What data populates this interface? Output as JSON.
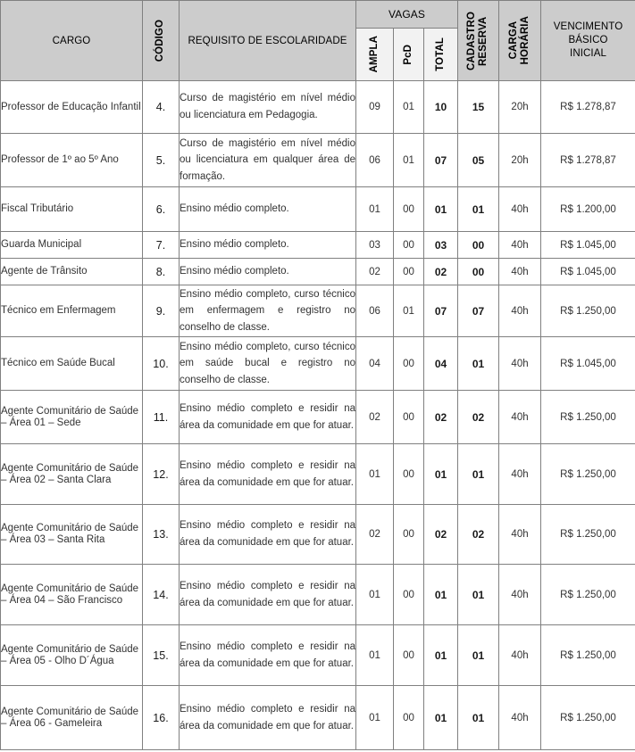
{
  "table": {
    "headers": {
      "cargo": "CARGO",
      "codigo": "CÓDIGO",
      "requisito": "REQUISITO DE ESCOLARIDADE",
      "vagas": "VAGAS",
      "ampla": "AMPLA",
      "pcd": "PcD",
      "total": "TOTAL",
      "cadastro_reserva_l1": "CADASTRO",
      "cadastro_reserva_l2": "RESERVA",
      "carga_horaria_l1": "CARGA",
      "carga_horaria_l2": "HORÁRIA",
      "vencimento_l1": "VENCIMENTO",
      "vencimento_l2": "BÁSICO",
      "vencimento_l3": "INICIAL"
    },
    "rows": [
      {
        "cargo": "Professor de Educação Infantil",
        "codigo": "4.",
        "requisito": "Curso de magistério em nível médio ou licenciatura em Pedagogia.",
        "ampla": "09",
        "pcd": "01",
        "total": "10",
        "cadastro_reserva": "15",
        "carga_horaria": "20h",
        "vencimento": "R$ 1.278,87"
      },
      {
        "cargo": "Professor de 1º ao 5º Ano",
        "codigo": "5.",
        "requisito": "Curso de magistério em nível médio ou licenciatura em qualquer área de formação.",
        "ampla": "06",
        "pcd": "01",
        "total": "07",
        "cadastro_reserva": "05",
        "carga_horaria": "20h",
        "vencimento": "R$ 1.278,87"
      },
      {
        "cargo": "Fiscal Tributário",
        "codigo": "6.",
        "requisito": "Ensino médio completo.",
        "ampla": "01",
        "pcd": "00",
        "total": "01",
        "cadastro_reserva": "01",
        "carga_horaria": "40h",
        "vencimento": "R$ 1.200,00"
      },
      {
        "cargo": "Guarda Municipal",
        "codigo": "7.",
        "requisito": "Ensino médio completo.",
        "ampla": "03",
        "pcd": "00",
        "total": "03",
        "cadastro_reserva": "00",
        "carga_horaria": "40h",
        "vencimento": "R$ 1.045,00"
      },
      {
        "cargo": "Agente de Trânsito",
        "codigo": "8.",
        "requisito": "Ensino médio completo.",
        "ampla": "02",
        "pcd": "00",
        "total": "02",
        "cadastro_reserva": "00",
        "carga_horaria": "40h",
        "vencimento": "R$ 1.045,00"
      },
      {
        "cargo": "Técnico em Enfermagem",
        "codigo": "9.",
        "requisito": "Ensino médio completo, curso técnico em enfermagem e registro no conselho de classe.",
        "ampla": "06",
        "pcd": "01",
        "total": "07",
        "cadastro_reserva": "07",
        "carga_horaria": "40h",
        "vencimento": "R$ 1.250,00"
      },
      {
        "cargo": "Técnico em Saúde Bucal",
        "codigo": "10.",
        "requisito": "Ensino médio completo, curso técnico em saúde bucal e registro no conselho de classe.",
        "ampla": "04",
        "pcd": "00",
        "total": "04",
        "cadastro_reserva": "01",
        "carga_horaria": "40h",
        "vencimento": "R$ 1.045,00"
      },
      {
        "cargo": "Agente Comunitário de Saúde – Área 01 – Sede",
        "codigo": "11.",
        "requisito": "Ensino médio completo e residir na área da comunidade em que for atuar.",
        "ampla": "02",
        "pcd": "00",
        "total": "02",
        "cadastro_reserva": "02",
        "carga_horaria": "40h",
        "vencimento": "R$ 1.250,00"
      },
      {
        "cargo": "Agente Comunitário de Saúde – Área 02 – Santa Clara",
        "codigo": "12.",
        "requisito": "Ensino médio completo e residir na área da comunidade em que for atuar.",
        "ampla": "01",
        "pcd": "00",
        "total": "01",
        "cadastro_reserva": "01",
        "carga_horaria": "40h",
        "vencimento": "R$ 1.250,00"
      },
      {
        "cargo": "Agente Comunitário de Saúde – Área 03 – Santa Rita",
        "codigo": "13.",
        "requisito": "Ensino médio completo e residir na área da comunidade em que for atuar.",
        "ampla": "02",
        "pcd": "00",
        "total": "02",
        "cadastro_reserva": "02",
        "carga_horaria": "40h",
        "vencimento": "R$ 1.250,00"
      },
      {
        "cargo": "Agente Comunitário de Saúde – Área 04 – São Francisco",
        "codigo": "14.",
        "requisito": "Ensino médio completo e residir na área da comunidade em que for atuar.",
        "ampla": "01",
        "pcd": "00",
        "total": "01",
        "cadastro_reserva": "01",
        "carga_horaria": "40h",
        "vencimento": "R$ 1.250,00"
      },
      {
        "cargo": "Agente Comunitário de Saúde – Área 05 - Olho D´Água",
        "codigo": "15.",
        "requisito": "Ensino médio completo e residir na área da comunidade em que for atuar.",
        "ampla": "01",
        "pcd": "00",
        "total": "01",
        "cadastro_reserva": "01",
        "carga_horaria": "40h",
        "vencimento": "R$ 1.250,00"
      },
      {
        "cargo": "Agente Comunitário de Saúde – Área 06 - Gameleira",
        "codigo": "16.",
        "requisito": "Ensino médio completo e residir na área da comunidade em que for atuar.",
        "ampla": "01",
        "pcd": "00",
        "total": "01",
        "cadastro_reserva": "01",
        "carga_horaria": "40h",
        "vencimento": "R$ 1.250,00"
      }
    ]
  },
  "colors": {
    "header_bg": "#cccccc",
    "subheader_bg": "#f2f2f2",
    "border": "#808080",
    "text": "#333333"
  }
}
